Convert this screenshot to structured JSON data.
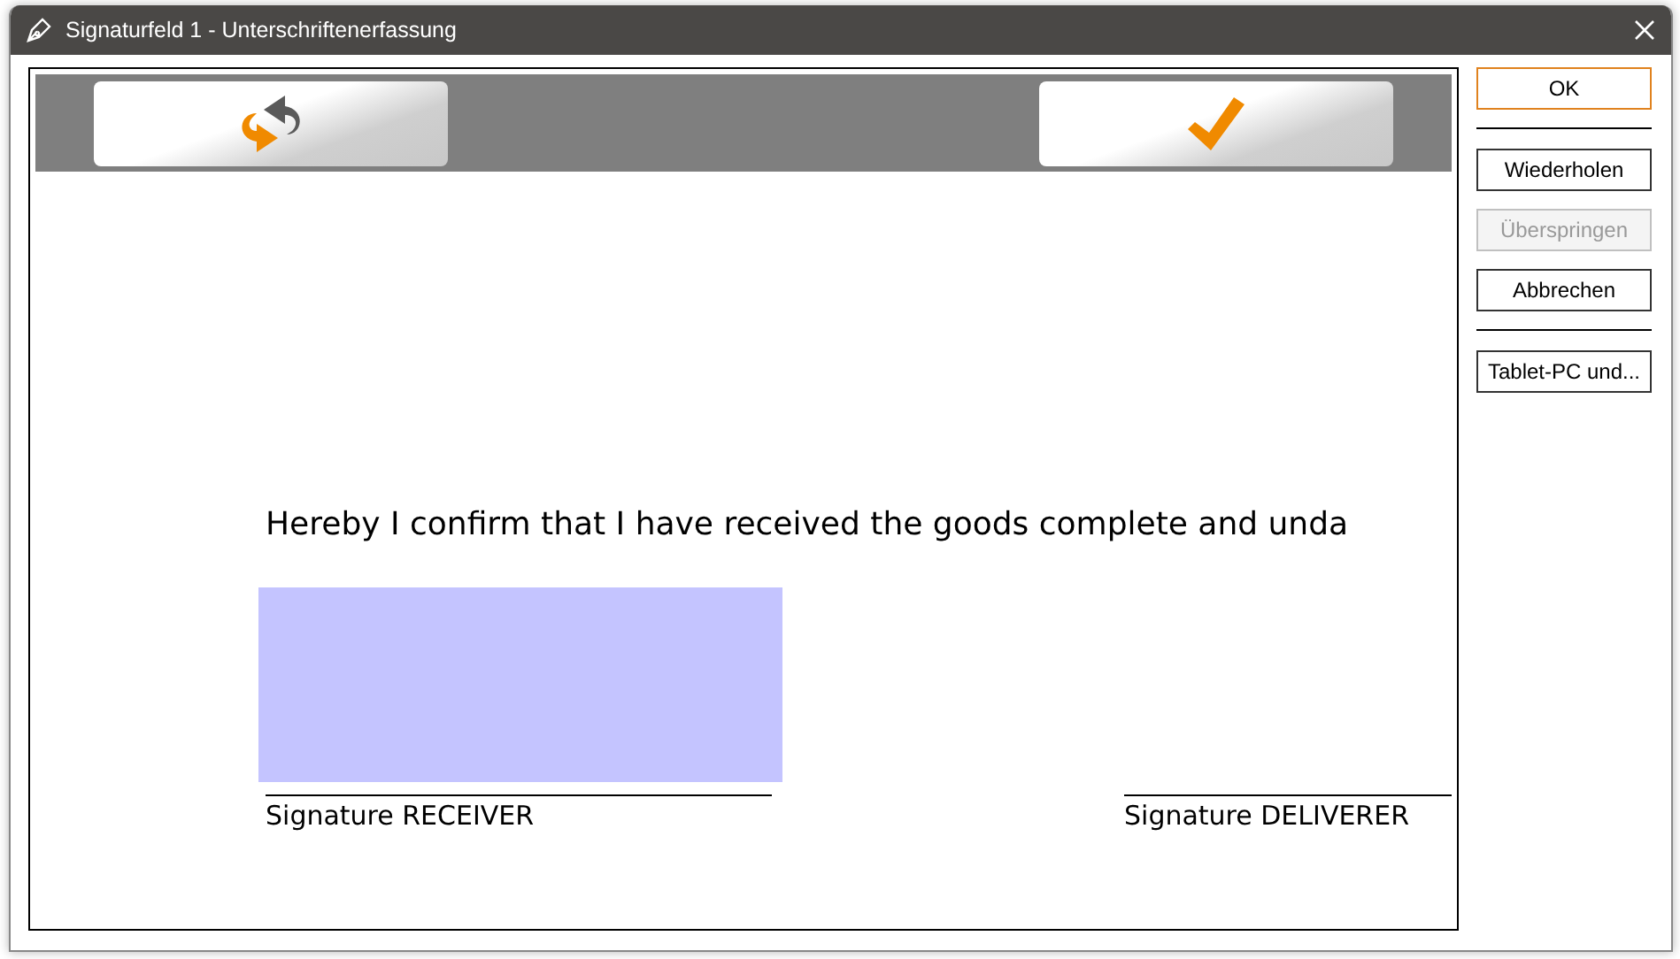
{
  "window": {
    "title": "Signaturfeld 1 - Unterschriftenerfassung"
  },
  "document": {
    "statement": "Hereby I confirm that I have received the goods complete and unda",
    "signatures": [
      {
        "label": "Signature RECEIVER",
        "highlighted": true
      },
      {
        "label": "Signature DELIVERER",
        "highlighted": false
      }
    ]
  },
  "side_panel": [
    {
      "kind": "button",
      "label": "OK",
      "default": true,
      "disabled": false
    },
    {
      "kind": "separator"
    },
    {
      "kind": "button",
      "label": "Wiederholen",
      "default": false,
      "disabled": false
    },
    {
      "kind": "button",
      "label": "Überspringen",
      "default": false,
      "disabled": true
    },
    {
      "kind": "button",
      "label": "Abbrechen",
      "default": false,
      "disabled": false
    },
    {
      "kind": "separator"
    },
    {
      "kind": "button",
      "label": "Tablet-PC und...",
      "default": false,
      "disabled": false
    }
  ]
}
